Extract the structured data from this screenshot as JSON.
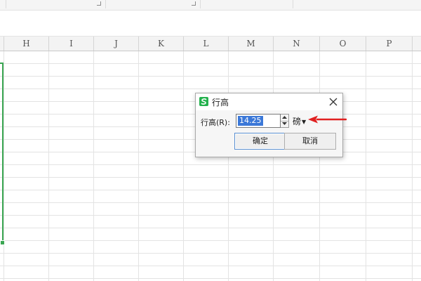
{
  "dialog": {
    "title": "行高",
    "field_label": "行高(R):",
    "value": "14.25",
    "unit": "磅",
    "ok_label": "确定",
    "cancel_label": "取消"
  },
  "columns": [
    "H",
    "I",
    "J",
    "K",
    "L",
    "M",
    "N",
    "O",
    "P"
  ],
  "colors": {
    "selection_border": "#3aa652",
    "app_icon": "#23b14d",
    "annotation_arrow": "#e02020",
    "input_highlight": "#3b78d8"
  },
  "icons": {
    "app": "wps-spreadsheet-icon",
    "close": "close-icon",
    "spin_up": "spin-up-icon",
    "spin_down": "spin-down-icon",
    "annotation": "red-arrow-icon"
  }
}
